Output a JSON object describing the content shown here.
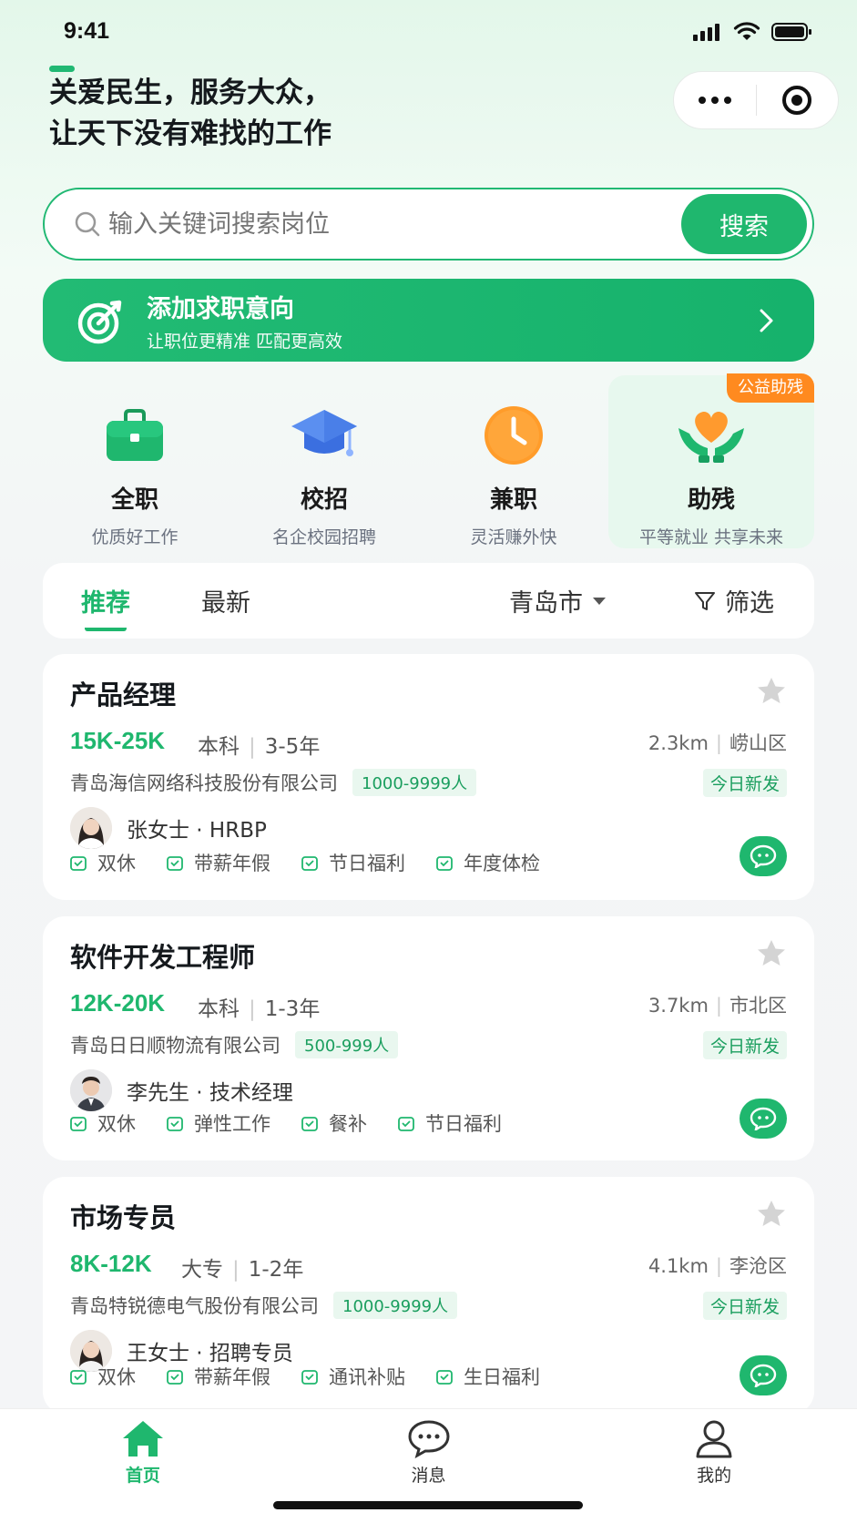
{
  "status": {
    "time": "9:41"
  },
  "header": {
    "slogan_line1": "关爱民生，服务大众，",
    "slogan_line2": "让天下没有难找的工作"
  },
  "search": {
    "placeholder": "输入关键词搜索岗位",
    "button": "搜索"
  },
  "intent": {
    "title": "添加求职意向",
    "subtitle": "让职位更精准 匹配更高效"
  },
  "categories": [
    {
      "name": "全职",
      "desc": "优质好工作",
      "icon": "briefcase-icon"
    },
    {
      "name": "校招",
      "desc": "名企校园招聘",
      "icon": "graduation-cap-icon"
    },
    {
      "name": "兼职",
      "desc": "灵活赚外快",
      "icon": "clock-icon"
    },
    {
      "name": "助残",
      "desc": "平等就业 共享未来",
      "icon": "hands-heart-icon",
      "badge": "公益助残"
    }
  ],
  "filters": {
    "tabs": [
      "推荐",
      "最新"
    ],
    "city": "青岛市",
    "filter": "筛选"
  },
  "jobs": [
    {
      "title": "产品经理",
      "salary": "15K-25K",
      "education": "本科",
      "experience": "3-5年",
      "distance": "2.3km",
      "district": "崂山区",
      "company": "青岛海信网络科技股份有限公司",
      "size": "1000-9999人",
      "new": "今日新发",
      "recruiter": "张女士 · HRBP",
      "perks": [
        "双休",
        "带薪年假",
        "节日福利",
        "年度体检"
      ]
    },
    {
      "title": "软件开发工程师",
      "salary": "12K-20K",
      "education": "本科",
      "experience": "1-3年",
      "distance": "3.7km",
      "district": "市北区",
      "company": "青岛日日顺物流有限公司",
      "size": "500-999人",
      "new": "今日新发",
      "recruiter": "李先生 · 技术经理",
      "perks": [
        "双休",
        "弹性工作",
        "餐补",
        "节日福利"
      ]
    },
    {
      "title": "市场专员",
      "salary": "8K-12K",
      "education": "大专",
      "experience": "1-2年",
      "distance": "4.1km",
      "district": "李沧区",
      "company": "青岛特锐德电气股份有限公司",
      "size": "1000-9999人",
      "new": "今日新发",
      "recruiter": "王女士 · 招聘专员",
      "perks": [
        "双休",
        "带薪年假",
        "通讯补贴",
        "生日福利"
      ]
    }
  ],
  "nav": [
    {
      "label": "首页"
    },
    {
      "label": "消息"
    },
    {
      "label": "我的"
    }
  ],
  "colors": {
    "primary": "#1fb76e",
    "accent": "#ff8a1f"
  }
}
